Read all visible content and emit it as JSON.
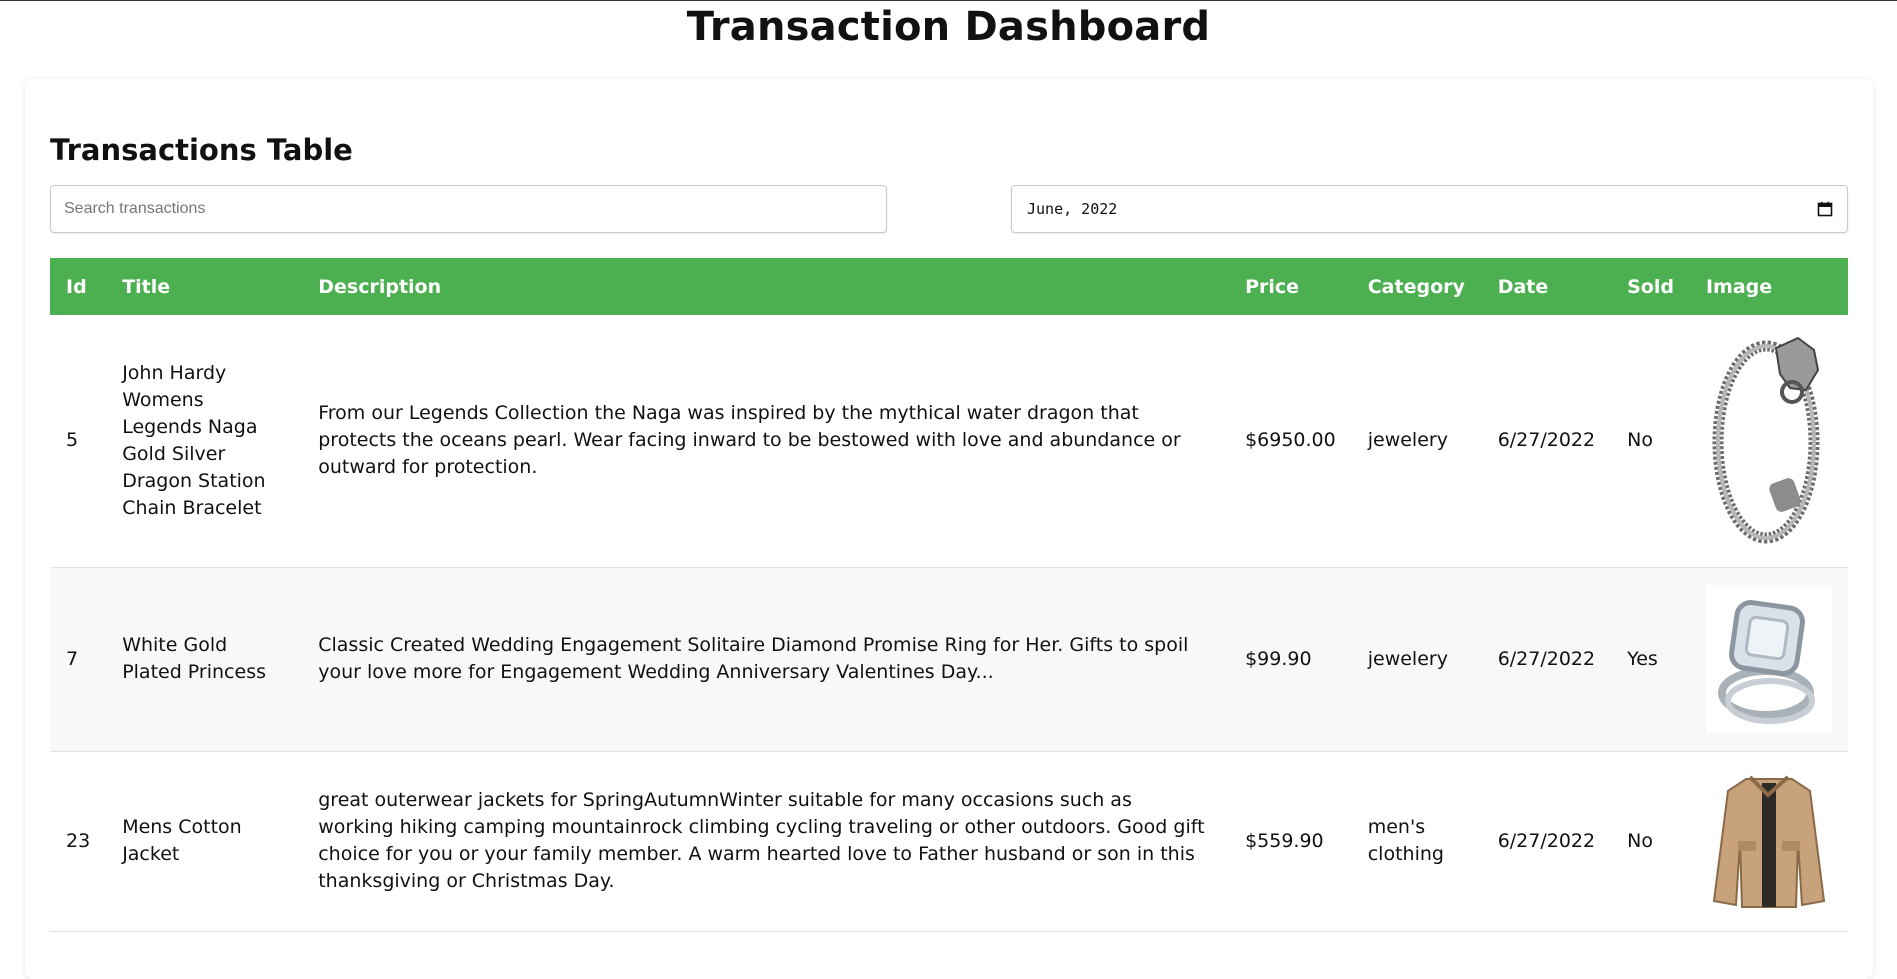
{
  "page": {
    "title": "Transaction Dashboard"
  },
  "table_section": {
    "title": "Transactions Table",
    "search": {
      "placeholder": "Search transactions",
      "value": ""
    },
    "month_picker": {
      "value": "June, 2022",
      "icon": "calendar-icon"
    }
  },
  "table": {
    "header_color": "#4caf50",
    "columns": [
      "Id",
      "Title",
      "Description",
      "Price",
      "Category",
      "Date",
      "Sold",
      "Image"
    ],
    "rows": [
      {
        "id": "5",
        "title": "John Hardy Womens Legends Naga Gold Silver Dragon Station Chain Bracelet",
        "description": "From our Legends Collection the Naga was inspired by the mythical water dragon that protects the oceans pearl. Wear facing inward to be bestowed with love and abundance or outward for protection.",
        "price": "$6950.00",
        "category": "jewelery",
        "date": "6/27/2022",
        "sold": "No",
        "image": "bracelet-image"
      },
      {
        "id": "7",
        "title": "White Gold Plated Princess",
        "description": "Classic Created Wedding Engagement Solitaire Diamond Promise Ring for Her. Gifts to spoil your love more for Engagement Wedding Anniversary Valentines Day...",
        "price": "$99.90",
        "category": "jewelery",
        "date": "6/27/2022",
        "sold": "Yes",
        "image": "ring-image"
      },
      {
        "id": "23",
        "title": "Mens Cotton Jacket",
        "description": "great outerwear jackets for SpringAutumnWinter suitable for many occasions such as working hiking camping mountainrock climbing cycling traveling or other outdoors. Good gift choice for you or your family member. A warm hearted love to Father husband or son in this thanksgiving or Christmas Day.",
        "price": "$559.90",
        "category": "men's clothing",
        "date": "6/27/2022",
        "sold": "No",
        "image": "jacket-image"
      }
    ]
  }
}
